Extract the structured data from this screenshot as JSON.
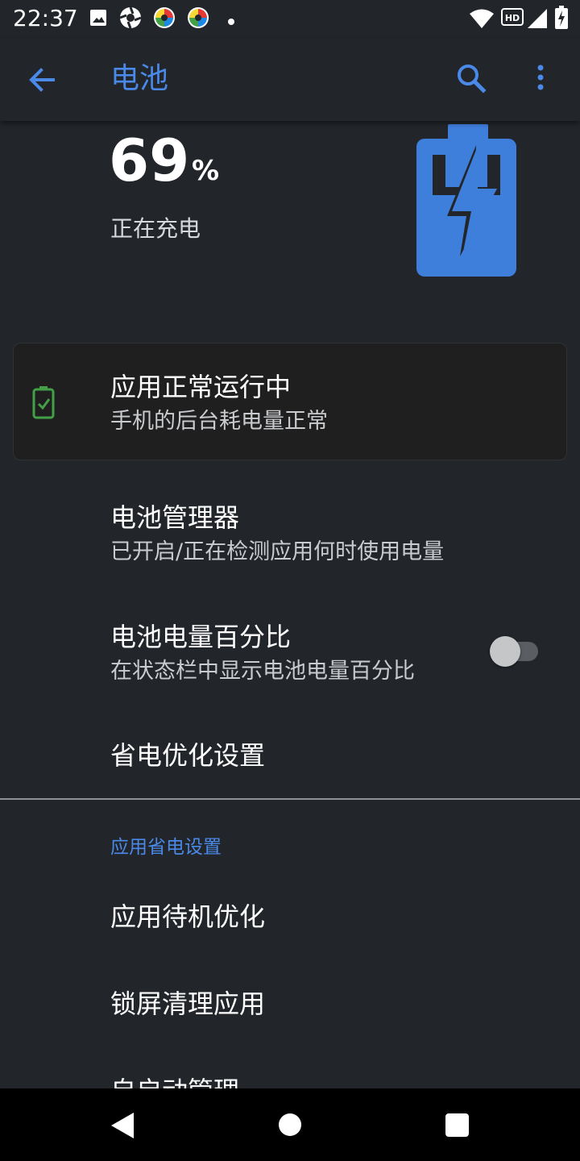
{
  "status_bar": {
    "time": "22:37",
    "icons": [
      "image-icon",
      "aperture-icon",
      "colorful-app-icon",
      "colorful-app-icon",
      "dot-icon",
      "wifi-icon",
      "hd-icon",
      "signal-icon",
      "battery-charging-icon"
    ],
    "hd_label": "HD"
  },
  "app_bar": {
    "title": "电池",
    "back_icon": "arrow-left-icon",
    "search_icon": "search-icon",
    "more_icon": "more-vertical-icon",
    "accent_color": "#4a89e8"
  },
  "battery": {
    "percent": "69",
    "unit": "%",
    "state": "正在充电",
    "level_fraction": 0.69,
    "graphic_color": "#3f7fdc"
  },
  "status_card": {
    "title": "应用正常运行中",
    "subtitle": "手机的后台耗电量正常",
    "icon": "battery-check-icon",
    "icon_color": "#43a047"
  },
  "items": [
    {
      "title": "电池管理器",
      "subtitle": "已开启/正在检测应用何时使用电量"
    },
    {
      "title": "电池电量百分比",
      "subtitle": "在状态栏中显示电池电量百分比",
      "toggle_on": false
    },
    {
      "title": "省电优化设置"
    }
  ],
  "section": {
    "header": "应用省电设置",
    "items": [
      {
        "title": "应用待机优化"
      },
      {
        "title": "锁屏清理应用"
      },
      {
        "title": "自启动管理"
      }
    ]
  },
  "nav_bar": {
    "back_icon": "nav-back-icon",
    "home_icon": "nav-home-icon",
    "recents_icon": "nav-recents-icon"
  }
}
